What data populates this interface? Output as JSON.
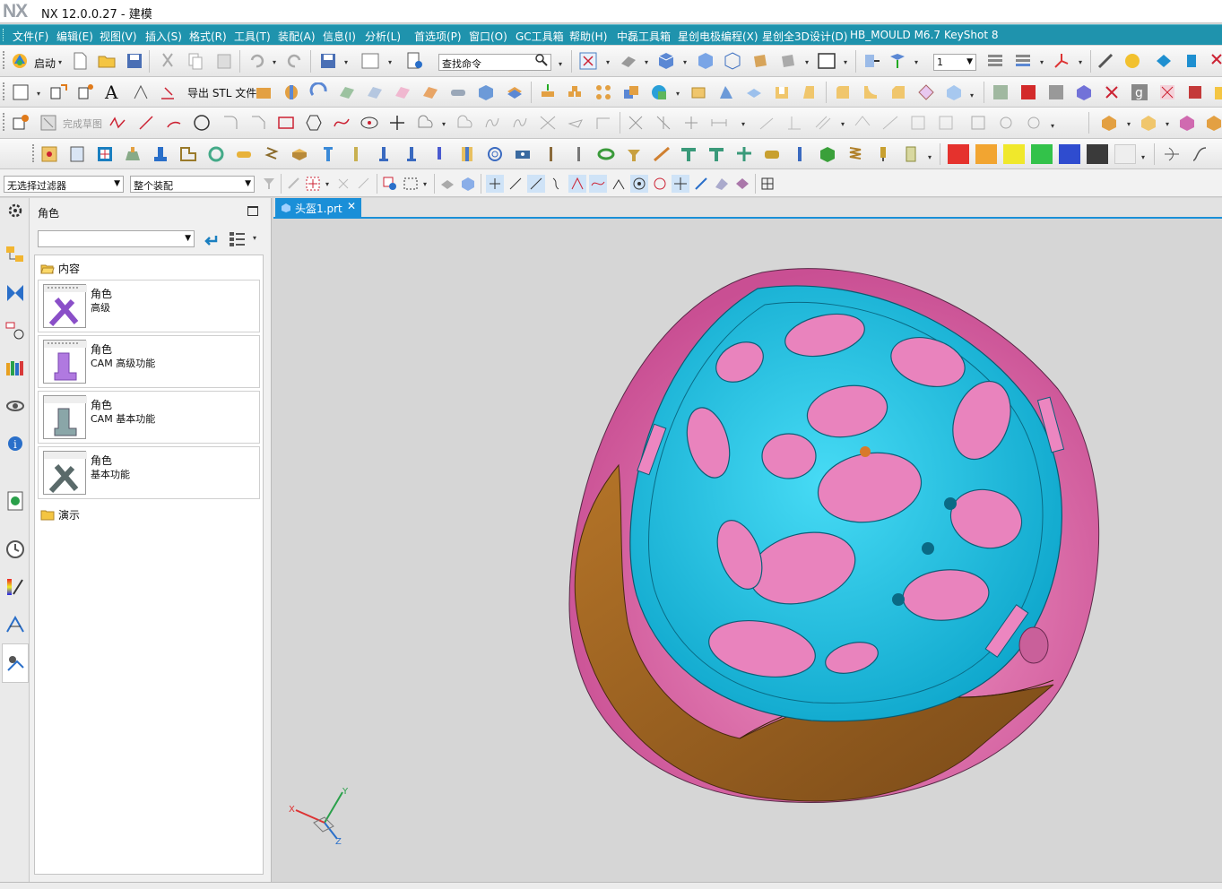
{
  "app": {
    "logo": "NX",
    "title": "NX 12.0.0.27 - 建模"
  },
  "menu": [
    "文件(F)",
    "编辑(E)",
    "视图(V)",
    "插入(S)",
    "格式(R)",
    "工具(T)",
    "装配(A)",
    "信息(I)",
    "分析(L)",
    "首选项(P)",
    "窗口(O)",
    "GC工具箱",
    "帮助(H)",
    "中磊工具箱",
    "星创电极编程(X)",
    "星创全3D设计(D)",
    "HB_MOULD M6.7",
    "KeyShot 8"
  ],
  "toolbar1": {
    "start_label": "启动",
    "search_placeholder": "查找命令",
    "layer_value": "1"
  },
  "toolbar2": {
    "export_stl_label": "导出 STL 文件"
  },
  "toolbar3": {
    "finish_sketch_label": "完成草图"
  },
  "palette_colors": [
    "#e5322d",
    "#f2a531",
    "#f0e82b",
    "#33c24a",
    "#2f4ccf",
    "#3a3a3a",
    "#eeeeee"
  ],
  "selection_bar": {
    "filter_value": "无选择过滤器",
    "scope_value": "整个装配"
  },
  "panel": {
    "title": "角色",
    "folders": {
      "content": "内容",
      "demo": "演示"
    },
    "roles": [
      {
        "line1": "角色",
        "line2": "高级",
        "icon": "advanced-role-icon"
      },
      {
        "line1": "角色",
        "line2": "CAM 高级功能",
        "icon": "cam-advanced-role-icon"
      },
      {
        "line1": "角色",
        "line2": "CAM 基本功能",
        "icon": "cam-basic-role-icon"
      },
      {
        "line1": "角色",
        "line2": "基本功能",
        "icon": "essentials-role-icon"
      }
    ]
  },
  "doc_tab": {
    "label": "头盔1.prt"
  },
  "axes": {
    "x": "X",
    "y": "Y",
    "z": "Z"
  },
  "model_colors": {
    "inner_shell": "#22c3e0",
    "foam": "#e070a8",
    "outer_shell": "#9a5e1f"
  }
}
